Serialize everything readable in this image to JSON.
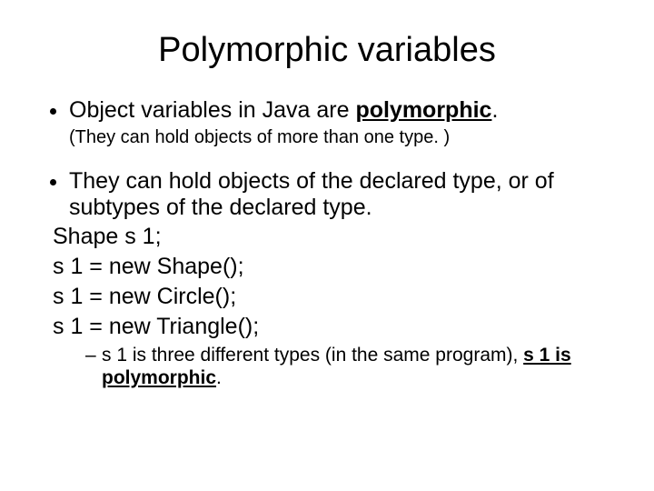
{
  "title": "Polymorphic variables",
  "bullet1_prefix": "Object variables in Java are ",
  "bullet1_emph": "polymorphic",
  "bullet1_suffix": ".",
  "sub1": "(They can hold objects of more than one type. )",
  "bullet2": "They can hold objects of the declared type, or of subtypes of the declared type.",
  "code1": "Shape s 1;",
  "code2": "s 1 = new Shape();",
  "code3": "s 1 = new Circle();",
  "code4": "s 1 = new Triangle();",
  "dash_prefix": "s 1 is three different types (in the same program), ",
  "dash_emph": "s 1 is polymorphic",
  "dash_suffix": "."
}
